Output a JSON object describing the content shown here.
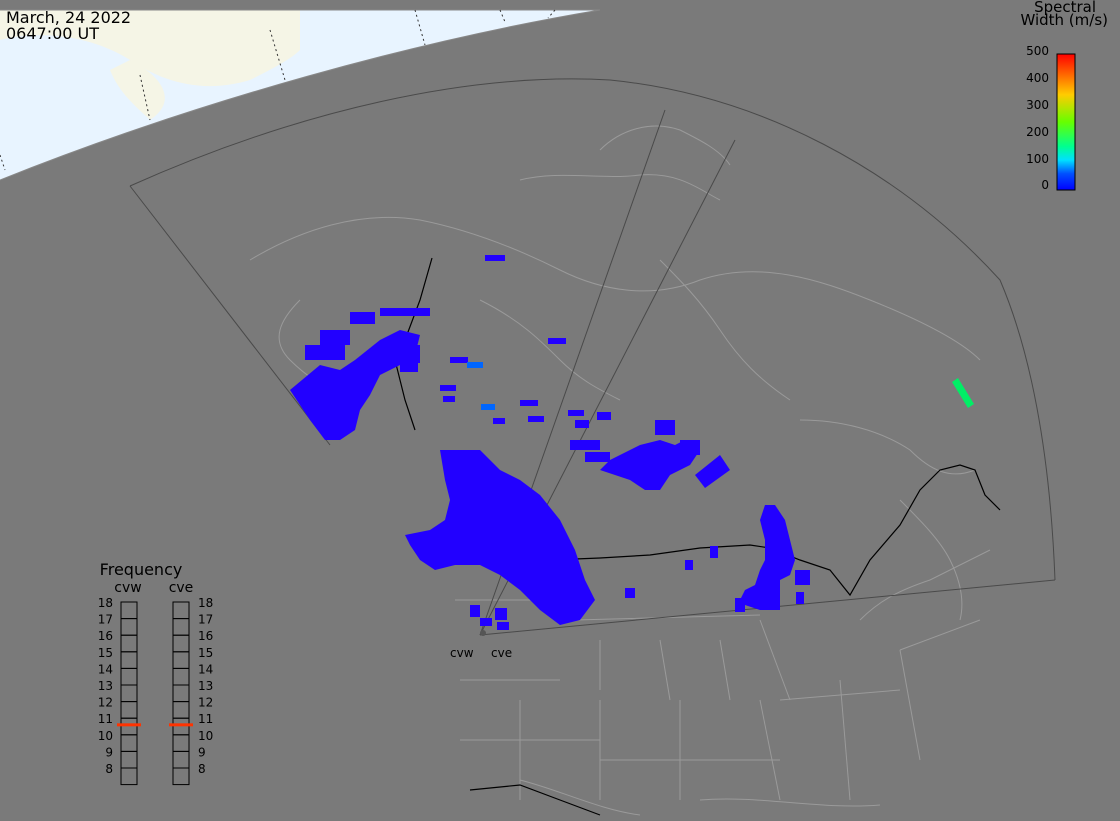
{
  "header": {
    "date": "March, 24 2022",
    "time": "0647:00 UT"
  },
  "colorbar": {
    "title_line1": "Spectral",
    "title_line2": "Width (m/s)",
    "ticks": [
      "500",
      "400",
      "300",
      "200",
      "100",
      "0"
    ],
    "colors": [
      "#ff0000",
      "#ffcc00",
      "#66ff00",
      "#00ff99",
      "#00e0ff",
      "#0040ff",
      "#0000ff"
    ]
  },
  "frequency_panel": {
    "title": "Frequency",
    "radars": [
      "cvw",
      "cve"
    ],
    "levels": [
      "18",
      "17",
      "16",
      "15",
      "14",
      "13",
      "12",
      "11",
      "10",
      "9",
      "8"
    ],
    "marker_color": "#ff3300"
  },
  "radar_sites": [
    "cvw",
    "cve"
  ],
  "colors": {
    "background": "#7a7a7a",
    "scatter": "#2200ff",
    "ocean": "#e8f4ff",
    "land": "#f5f5e6"
  }
}
